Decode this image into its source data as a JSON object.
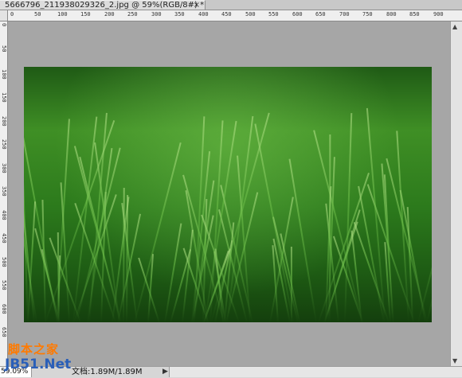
{
  "tab": {
    "title": "5666796_211938029326_2.jpg @ 59%(RGB/8#) *",
    "close": "×"
  },
  "rulers": {
    "top_labels": [
      "0",
      "50",
      "100",
      "150",
      "200",
      "250",
      "300",
      "350",
      "400",
      "450",
      "500",
      "550",
      "600",
      "650",
      "700",
      "750",
      "800",
      "850",
      "900"
    ],
    "left_labels": [
      "0",
      "50",
      "100",
      "150",
      "200",
      "250",
      "300",
      "350",
      "400",
      "450",
      "500",
      "550",
      "600",
      "650"
    ]
  },
  "status": {
    "zoom": "59.09%",
    "doc": "文档:1.89M/1.89M",
    "arrow": "▶"
  },
  "watermark": {
    "line1": "脚本之家",
    "line2": "JB51.Net"
  },
  "colors": {
    "canvas_bg": "#a6a6a6",
    "grass_dark": "#1f5a15",
    "grass_light": "#6fc04a"
  }
}
